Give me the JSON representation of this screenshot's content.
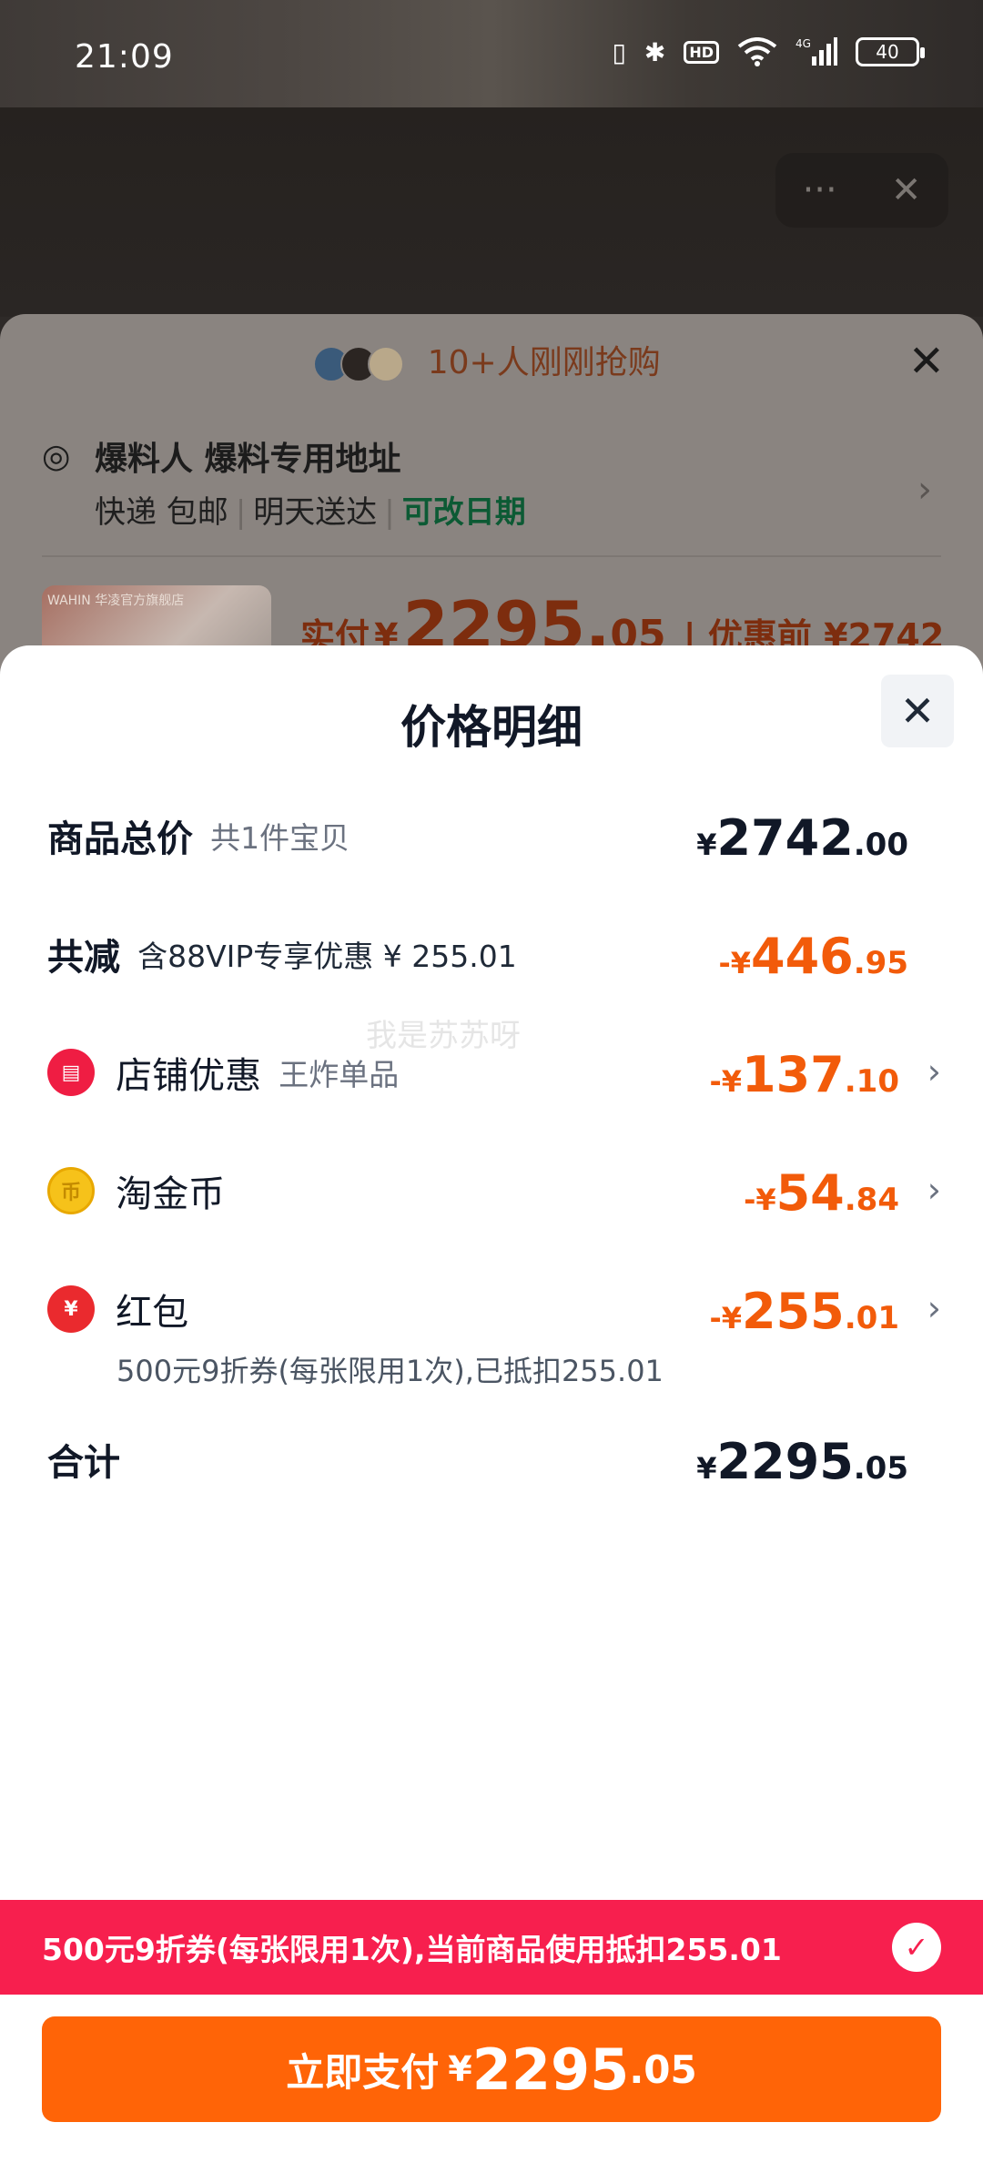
{
  "status_bar": {
    "time": "21:09",
    "battery": "40",
    "network": "4G",
    "hd": "HD"
  },
  "background": {
    "notice": "10+人刚刚抢购",
    "address": {
      "name": "爆料人 爆料专用地址",
      "delivery": "快递 包邮",
      "arrival": "明天送达",
      "change_date": "可改日期"
    },
    "product_thumb_text": "WAHIN 华凌官方旗舰店",
    "price_label": "实付",
    "currency": "¥",
    "price_int": "2295.",
    "price_dec": "05",
    "before_discount": "优惠前 ¥2742"
  },
  "sheet": {
    "title": "价格明细",
    "rows": {
      "total": {
        "label": "商品总价",
        "sub": "共1件宝贝",
        "cur": "¥",
        "int": "2742",
        "dec": ".00"
      },
      "discount": {
        "label": "共减",
        "sub": "含88VIP专享优惠 ¥ 255.01",
        "cur": "-¥",
        "int": "446",
        "dec": ".95"
      },
      "shop": {
        "label": "店铺优惠",
        "sub": "王炸单品",
        "cur": "-¥",
        "int": "137",
        "dec": ".10"
      },
      "coin": {
        "label": "淘金币",
        "cur": "-¥",
        "int": "54",
        "dec": ".84"
      },
      "hongbao": {
        "label": "红包",
        "note": "500元9折券(每张限用1次),已抵扣255.01",
        "cur": "-¥",
        "int": "255",
        "dec": ".01"
      },
      "sum": {
        "label": "合计",
        "cur": "¥",
        "int": "2295",
        "dec": ".05"
      }
    },
    "watermark": "我是苏苏呀"
  },
  "coupon_banner": {
    "text": "500元9折券(每张限用1次),当前商品使用抵扣255.01"
  },
  "pay_button": {
    "label": "立即支付",
    "cur": "¥",
    "int": "2295",
    "dec": ".05"
  },
  "colors": {
    "accent_orange": "#ff6407",
    "discount_orange": "#f25b0a",
    "banner_red": "#f71f4e"
  }
}
